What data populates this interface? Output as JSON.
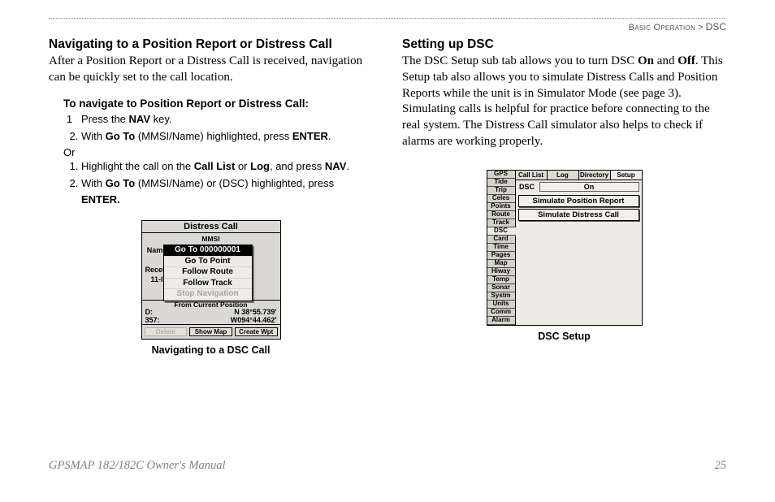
{
  "breadcrumb": {
    "section": "Basic Operation",
    "sep": ">",
    "leaf": "DSC"
  },
  "left": {
    "heading": "Navigating to a Position Report or Distress Call",
    "para": "After a Position Report or a Distress Call is received, navigation can be quickly set to the call location.",
    "subhead": "To navigate to Position Report or Distress Call:",
    "stepsA": {
      "s1_pre": "Press the ",
      "s1_b": "NAV",
      "s1_post": " key.",
      "s2_pre": "With ",
      "s2_b1": "Go To",
      "s2_mid": " (MMSI/Name) highlighted, press ",
      "s2_b2": "ENTER",
      "s2_post": "."
    },
    "or": "Or",
    "stepsB": {
      "s1_pre": "Highlight the call on the ",
      "s1_b1": "Call List",
      "s1_mid": " or ",
      "s1_b2": "Log",
      "s1_mid2": ", and press ",
      "s1_b3": "NAV",
      "s1_post": ".",
      "s2_pre": "With ",
      "s2_b1": "Go To",
      "s2_mid": " (MMSI/Name) or (DSC) highlighted, press ",
      "s2_b2": "ENTER.",
      "s2_post": ""
    },
    "fig": {
      "title": "Distress Call",
      "mmsi_lbl": "MMSI",
      "name_lbl": "Name",
      "recv_lbl": "Receiv",
      "recv_val": "11-I",
      "menu": [
        "Go To 000000001",
        "Go To Point",
        "Follow Route",
        "Follow Track",
        "Stop Navigation"
      ],
      "frompos": "From Current Position",
      "d_lbl": "D:",
      "brg_lbl": "357:",
      "lat": "N 38°55.739'",
      "lon": "W094°44.462'",
      "btns": [
        "Delete",
        "Show Map",
        "Create Wpt"
      ],
      "caption": "Navigating to a DSC Call"
    }
  },
  "right": {
    "heading": "Setting up DSC",
    "para_pre": "The DSC Setup sub tab allows you to turn DSC ",
    "para_b1": "On",
    "para_mid1": " and ",
    "para_b2": "Off",
    "para_post": ". This Setup tab also allows you to simulate Distress Calls and Position Reports while the unit is in Simulator Mode (see page 3). Simulating calls is helpful for practice before connecting to the real system. The Distress Call simulator also helps to check if alarms are working properly.",
    "fig": {
      "tabs": [
        "GPS",
        "Tide",
        "Trip",
        "Celes",
        "Points",
        "Route",
        "Track",
        "DSC",
        "Card",
        "Time",
        "Pages",
        "Map",
        "Hiway",
        "Temp",
        "Sonar",
        "Systm",
        "Units",
        "Comm",
        "Alarm"
      ],
      "subtabs": [
        "Call List",
        "Log",
        "Directory",
        "Setup"
      ],
      "dsc_lbl": "DSC",
      "dsc_val": "On",
      "btn1": "Simulate Position Report",
      "btn2": "Simulate Distress Call",
      "caption": "DSC Setup"
    }
  },
  "footer": {
    "left": "GPSMAP 182/182C Owner's Manual",
    "right": "25"
  }
}
